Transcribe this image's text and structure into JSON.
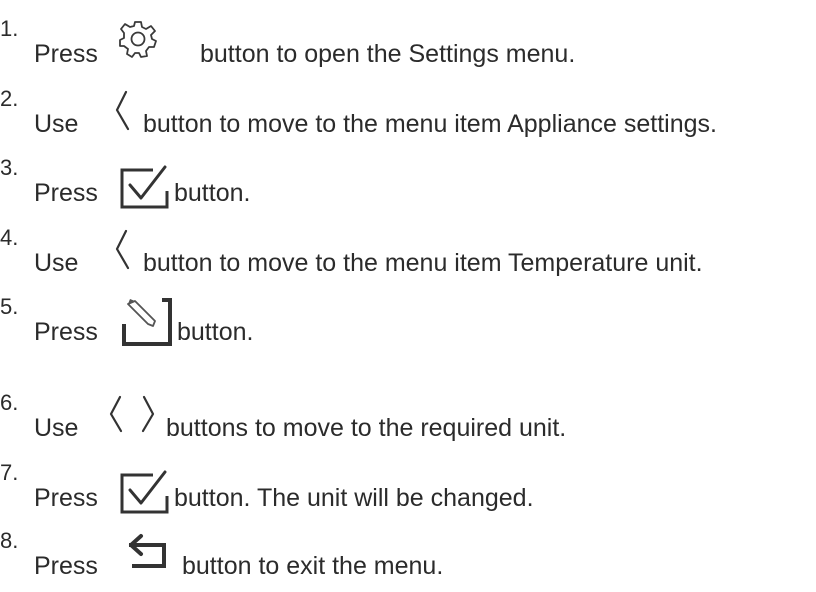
{
  "steps": [
    {
      "num": "1.",
      "pre": "Press",
      "icon": "gear-icon",
      "post": "button to open the Settings menu."
    },
    {
      "num": "2.",
      "pre": "Use",
      "icon": "chevron-left-icon",
      "post": "button to move to the menu item Appliance settings."
    },
    {
      "num": "3.",
      "pre": "Press",
      "icon": "checkbox-icon",
      "post": "button."
    },
    {
      "num": "4.",
      "pre": "Use",
      "icon": "chevron-left-icon",
      "post": "button to move to the menu item Temperature unit."
    },
    {
      "num": "5.",
      "pre": "Press",
      "icon": "edit-icon",
      "post": "button."
    },
    {
      "num": "6.",
      "pre": "Use",
      "icon": "chevron-left-right-icon",
      "post": "buttons to move to the required unit."
    },
    {
      "num": "7.",
      "pre": "Press",
      "icon": "checkbox-icon",
      "post": "button. The unit will be changed."
    },
    {
      "num": "8.",
      "pre": "Press",
      "icon": "back-icon",
      "post": "button to exit the menu."
    }
  ]
}
